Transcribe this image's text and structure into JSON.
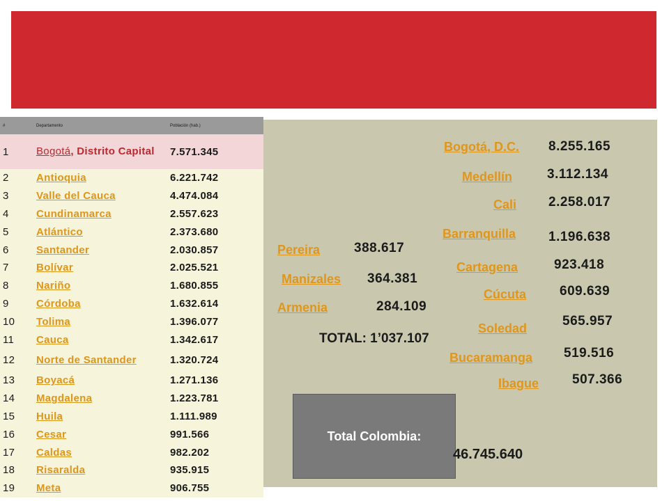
{
  "colors": {
    "banner": "#d0282f",
    "panel": "#c9c8ae",
    "link": "#e0961a",
    "first_row": "#f3d6d8",
    "rows": "#f7f4dc"
  },
  "table": {
    "headers": [
      "#",
      "Departamento",
      "Población (hab.)"
    ],
    "rows": [
      {
        "num": "1",
        "name": "Bogotá",
        "name_rest": ", Distrito Capital",
        "population": "7.571.345"
      },
      {
        "num": "2",
        "name": "Antioquia",
        "population": "6.221.742"
      },
      {
        "num": "3",
        "name": "Valle del Cauca",
        "population": "4.474.084"
      },
      {
        "num": "4",
        "name": "Cundinamarca",
        "population": "2.557.623"
      },
      {
        "num": "5",
        "name": "Atlántico",
        "population": "2.373.680"
      },
      {
        "num": "6",
        "name": "Santander",
        "population": "2.030.857"
      },
      {
        "num": "7",
        "name": "Bolívar",
        "population": "2.025.521"
      },
      {
        "num": "8",
        "name": "Nariño",
        "population": "1.680.855"
      },
      {
        "num": "9",
        "name": "Córdoba",
        "population": "1.632.614"
      },
      {
        "num": "10",
        "name": "Tolima",
        "population": "1.396.077"
      },
      {
        "num": "11",
        "name": "Cauca",
        "population": "1.342.617"
      },
      {
        "num": "12",
        "name": "Norte de Santander",
        "population": "1.320.724"
      },
      {
        "num": "13",
        "name": "Boyacá",
        "population": "1.271.136"
      },
      {
        "num": "14",
        "name": "Magdalena",
        "population": "1.223.781"
      },
      {
        "num": "15",
        "name": "Huila",
        "population": "1.111.989"
      },
      {
        "num": "16",
        "name": "Cesar",
        "population": "991.566"
      },
      {
        "num": "17",
        "name": "Caldas",
        "population": "982.202"
      },
      {
        "num": "18",
        "name": "Risaralda",
        "population": "935.915"
      },
      {
        "num": "19",
        "name": "Meta",
        "population": "906.755"
      }
    ]
  },
  "cities": {
    "bogota": {
      "name": "Bogotá, D.C.",
      "population": "8.255.165"
    },
    "medellin": {
      "name": "Medellín",
      "population": "3.112.134"
    },
    "cali": {
      "name": "Cali",
      "population": "2.258.017"
    },
    "barranquilla": {
      "name": "Barranquilla",
      "population": "1.196.638"
    },
    "cartagena": {
      "name": "Cartagena",
      "population": "923.418"
    },
    "cucuta": {
      "name": "Cúcuta",
      "population": "609.639"
    },
    "soledad": {
      "name": "Soledad",
      "population": "565.957"
    },
    "bucaramanga": {
      "name": "Bucaramanga",
      "population": "519.516"
    },
    "ibague": {
      "name": "Ibague",
      "population": "507.366"
    },
    "pereira": {
      "name": "Pereira",
      "population": "388.617"
    },
    "manizales": {
      "name": "Manizales",
      "population": "364.381"
    },
    "armenia": {
      "name": "Armenia",
      "population": "284.109"
    }
  },
  "coffee_total": "TOTAL: 1’037.107",
  "total_colombia": {
    "label": "Total  Colombia:",
    "value": "46.745.640"
  }
}
